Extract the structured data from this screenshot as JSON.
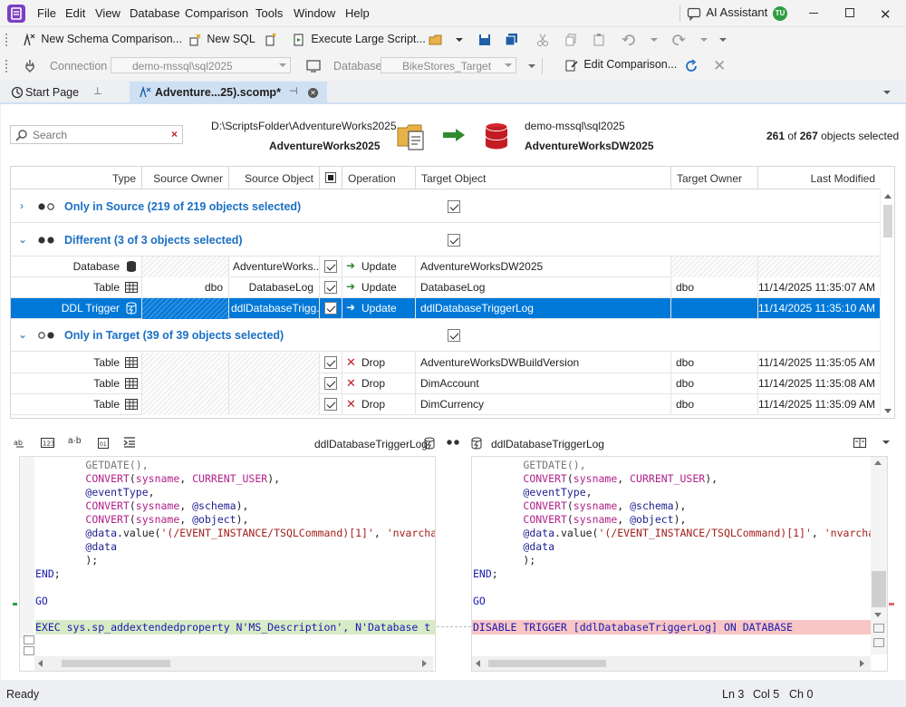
{
  "menu": [
    "File",
    "Edit",
    "View",
    "Database",
    "Comparison",
    "Tools",
    "Window",
    "Help"
  ],
  "ai_assistant": "AI Assistant",
  "user_initials": "TU",
  "toolbar1": {
    "new_schema_comparison": "New Schema Comparison...",
    "new_sql": "New SQL",
    "execute_large_script": "Execute Large Script..."
  },
  "toolbar2": {
    "connection_label": "Connection",
    "connection_value": "demo-mssql\\sql2025",
    "database_label": "Database",
    "database_value": "BikeStores_Target",
    "edit_comparison": "Edit Comparison..."
  },
  "tabs": {
    "start_page": "Start Page",
    "active": "Adventure...25).scomp*"
  },
  "search_placeholder": "Search",
  "source": {
    "path": "D:\\ScriptsFolder\\AdventureWorks2025",
    "name": "AdventureWorks2025"
  },
  "target": {
    "server": "demo-mssql\\sql2025",
    "name": "AdventureWorksDW2025"
  },
  "selection": {
    "count": "261",
    "of": "of",
    "total": "267",
    "suffix": "objects selected"
  },
  "columns": [
    "Type",
    "Source Owner",
    "Source Object",
    "",
    "Operation",
    "Target Object",
    "Target Owner",
    "Last Modified"
  ],
  "groups": [
    {
      "label": "Only in Source (219 of 219 objects selected)"
    },
    {
      "label": "Different (3 of 3 objects selected)"
    },
    {
      "label": "Only in Target (39 of 39 objects selected)"
    }
  ],
  "rows": [
    {
      "type": "Database",
      "src_owner": "",
      "src_obj": "AdventureWorks...",
      "op": "Update",
      "tgt_obj": "AdventureWorksDW2025",
      "tgt_owner": "",
      "modified": ""
    },
    {
      "type": "Table",
      "src_owner": "dbo",
      "src_obj": "DatabaseLog",
      "op": "Update",
      "tgt_obj": "DatabaseLog",
      "tgt_owner": "dbo",
      "modified": "11/14/2025 11:35:07 AM"
    },
    {
      "type": "DDL Trigger",
      "src_owner": "",
      "src_obj": "ddlDatabaseTrigg...",
      "op": "Update",
      "tgt_obj": "ddlDatabaseTriggerLog",
      "tgt_owner": "",
      "modified": "11/14/2025 11:35:10 AM"
    },
    {
      "type": "Table",
      "src_owner": "",
      "src_obj": "",
      "op": "Drop",
      "tgt_obj": "AdventureWorksDWBuildVersion",
      "tgt_owner": "dbo",
      "modified": "11/14/2025 11:35:05 AM"
    },
    {
      "type": "Table",
      "src_owner": "",
      "src_obj": "",
      "op": "Drop",
      "tgt_obj": "DimAccount",
      "tgt_owner": "dbo",
      "modified": "11/14/2025 11:35:08 AM"
    },
    {
      "type": "Table",
      "src_owner": "",
      "src_obj": "",
      "op": "Drop",
      "tgt_obj": "DimCurrency",
      "tgt_owner": "dbo",
      "modified": "11/14/2025 11:35:09 AM"
    }
  ],
  "diff": {
    "left_title": "ddlDatabaseTriggerLog",
    "right_title": "ddlDatabaseTriggerLog",
    "left_last": "EXEC sys.sp_addextendedproperty N'MS_Description', N'Database t",
    "right_last": "DISABLE TRIGGER [ddlDatabaseTriggerLog] ON DATABASE"
  },
  "status": {
    "ready": "Ready",
    "ln": "Ln 3",
    "col": "Col 5",
    "ch": "Ch 0"
  },
  "colors": {
    "accent": "#0078d7",
    "group_text": "#1a6fc4",
    "added": "#d8ebc6",
    "removed": "#f8c6c6"
  }
}
